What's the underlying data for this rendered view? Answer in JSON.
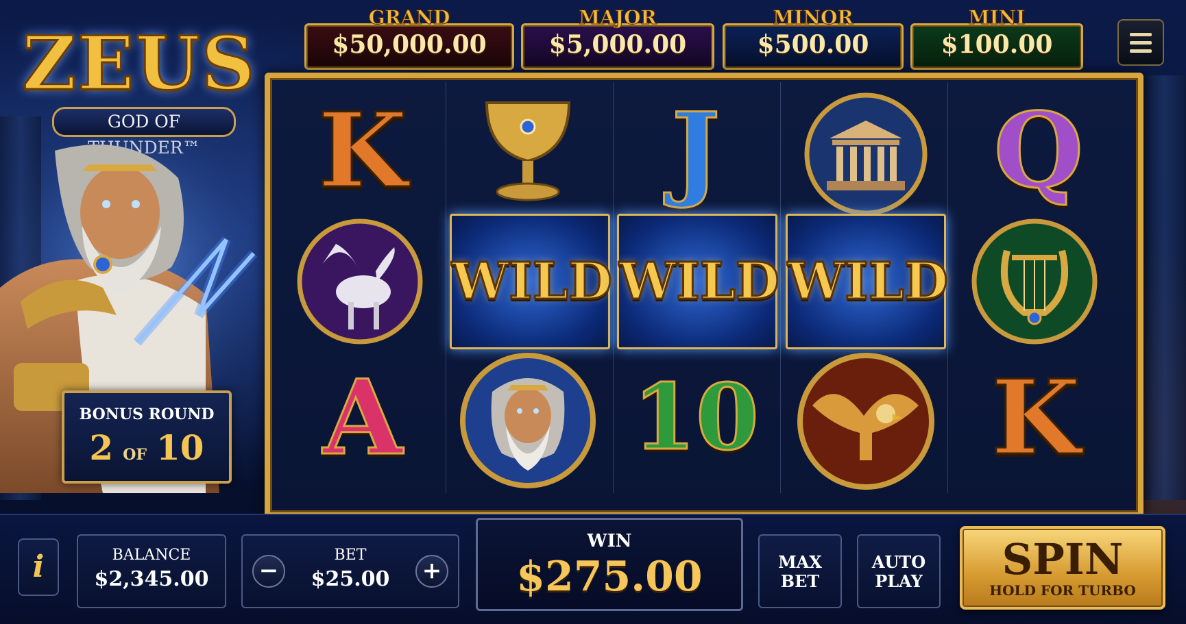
{
  "logo": {
    "title": "ZEUS",
    "subtitle": "GOD OF THUNDER™"
  },
  "jackpots": [
    {
      "name": "GRAND",
      "amount": "$50,000.00",
      "color": "#3a0c12"
    },
    {
      "name": "MAJOR",
      "amount": "$5,000.00",
      "color": "#2a0f4c"
    },
    {
      "name": "MINOR",
      "amount": "$500.00",
      "color": "#0b2156"
    },
    {
      "name": "MINI",
      "amount": "$100.00",
      "color": "#0c3a1a"
    }
  ],
  "menu": {
    "icon": "hamburger-menu-icon"
  },
  "bonus_round": {
    "label": "BONUS ROUND",
    "current": "2",
    "of": "OF",
    "total": "10"
  },
  "reels": {
    "row1": [
      {
        "symbol": "K",
        "color": "#e2782a"
      },
      {
        "symbol": "goblet-icon"
      },
      {
        "symbol": "J",
        "color": "#2f7de0"
      },
      {
        "symbol": "temple-icon"
      },
      {
        "symbol": "Q",
        "color": "#a04fc8"
      }
    ],
    "row2": [
      {
        "symbol": "pegasus-icon"
      },
      {
        "symbol": "WILD"
      },
      {
        "symbol": "WILD"
      },
      {
        "symbol": "WILD"
      },
      {
        "symbol": "lyre-icon"
      }
    ],
    "row3": [
      {
        "symbol": "A",
        "color": "#d9336a"
      },
      {
        "symbol": "zeus-portrait-icon"
      },
      {
        "symbol": "10",
        "color": "#2f9a3c"
      },
      {
        "symbol": "eagle-icon"
      },
      {
        "symbol": "K",
        "color": "#e2782a"
      }
    ]
  },
  "controls": {
    "info": "i",
    "balance_label": "BALANCE",
    "balance_value": "$2,345.00",
    "bet_label": "BET",
    "bet_value": "$25.00",
    "bet_minus": "−",
    "bet_plus": "+",
    "win_label": "WIN",
    "win_value": "$275.00",
    "max_bet_line1": "MAX",
    "max_bet_line2": "BET",
    "auto_play_line1": "AUTO",
    "auto_play_line2": "PLAY",
    "spin_label": "SPIN",
    "spin_sub": "HOLD FOR TURBO"
  }
}
